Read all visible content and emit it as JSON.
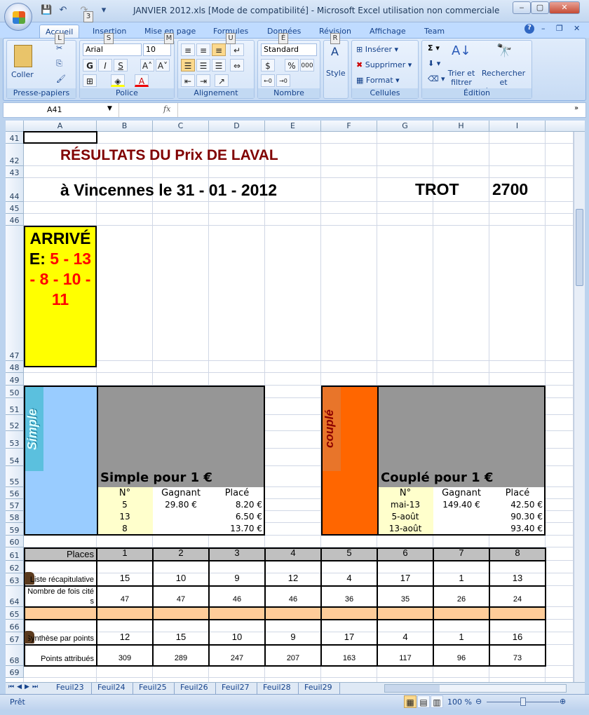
{
  "window": {
    "title": "JANVIER 2012.xls  [Mode de compatibilité] - Microsoft Excel utilisation non commerciale",
    "qat_key": "3"
  },
  "ribbon": {
    "tabs": [
      {
        "label": "Accueil",
        "key": "L"
      },
      {
        "label": "Insertion",
        "key": "S"
      },
      {
        "label": "Mise en page",
        "key": "M"
      },
      {
        "label": "Formules",
        "key": "U"
      },
      {
        "label": "Données",
        "key": "É"
      },
      {
        "label": "Révision",
        "key": "R"
      },
      {
        "label": "Affichage"
      },
      {
        "label": "Team"
      }
    ],
    "clipboard": {
      "paste": "Coller",
      "group": "Presse-papiers"
    },
    "font": {
      "name": "Arial",
      "size": "10",
      "bold": "G",
      "italic": "I",
      "underline": "S",
      "group": "Police"
    },
    "alignment": {
      "group": "Alignement"
    },
    "number": {
      "format": "Standard",
      "percent": "%",
      "thousands": "000",
      "group": "Nombre"
    },
    "style": {
      "label": "Style"
    },
    "cells": {
      "insert": "Insérer",
      "delete": "Supprimer",
      "format": "Format",
      "group": "Cellules"
    },
    "editing": {
      "sort": "Trier et filtrer",
      "find": "Rechercher et sélectionner",
      "group": "Édition"
    }
  },
  "formula_bar": {
    "name_box": "A41",
    "fx": "fx",
    "formula": ""
  },
  "columns": [
    "A",
    "B",
    "C",
    "D",
    "E",
    "F",
    "G",
    "H",
    "I"
  ],
  "rows": [
    "41",
    "42",
    "43",
    "44",
    "45",
    "46",
    "47",
    "48",
    "49",
    "50",
    "51",
    "52",
    "53",
    "54",
    "55",
    "56",
    "57",
    "58",
    "59",
    "60",
    "61",
    "62",
    "63",
    "64",
    "65",
    "66",
    "67",
    "68",
    "69"
  ],
  "sheet": {
    "title": "RÉSULTATS DU Prix DE LAVAL",
    "location": "à Vincennes le 31 - 01 - 2012",
    "race_type": "TROT",
    "distance": "2700",
    "arrival_label": "ARRIVÉE:",
    "arrival_value": "5 - 13 - 8 - 10 - 11",
    "simple": {
      "wordart": "Simple",
      "heading": "Simple pour 1 €",
      "headers": [
        "N°",
        "Gagnant",
        "Placé"
      ],
      "rows": [
        [
          "5",
          "29.80 €",
          "8.20 €"
        ],
        [
          "13",
          "",
          "6.50 €"
        ],
        [
          "8",
          "",
          "13.70 €"
        ]
      ]
    },
    "couple": {
      "wordart": "couplé",
      "heading": "Couplé pour 1 €",
      "headers": [
        "N°",
        "Gagnant",
        "Placé"
      ],
      "rows": [
        [
          "mai-13",
          "149.40 €",
          "42.50 €"
        ],
        [
          "5-août",
          "",
          "90.30 €"
        ],
        [
          "13-août",
          "",
          "93.40 €"
        ]
      ]
    },
    "summary": {
      "places_label": "Places",
      "places": [
        "1",
        "2",
        "3",
        "4",
        "5",
        "6",
        "7",
        "8"
      ],
      "recap_label": "Liste récapitulative",
      "recap": [
        "15",
        "10",
        "9",
        "12",
        "4",
        "17",
        "1",
        "13"
      ],
      "cited_label": "Nombre de fois cités",
      "cited": [
        "47",
        "47",
        "46",
        "46",
        "36",
        "35",
        "26",
        "24"
      ],
      "synth_label": "Synthèse par points",
      "synth": [
        "12",
        "15",
        "10",
        "9",
        "17",
        "4",
        "1",
        "16"
      ],
      "points_label": "Points attribués",
      "points": [
        "309",
        "289",
        "247",
        "207",
        "163",
        "117",
        "96",
        "73"
      ]
    }
  },
  "sheet_tabs": [
    "Feuil23",
    "Feuil24",
    "Feuil25",
    "Feuil26",
    "Feuil27",
    "Feuil28",
    "Feuil29"
  ],
  "status": {
    "ready": "Prêt",
    "zoom": "100 %",
    "zoom_level_percent": 100
  },
  "colors": {
    "arrival_bg": "#ffff00",
    "arrival_red": "#ff0000",
    "title_red": "#800000",
    "simple_blue": "#99ccff",
    "couple_orange": "#ff6600",
    "grey": "#969696",
    "light_yellow": "#ffffcc",
    "peach": "#ffcc99"
  }
}
